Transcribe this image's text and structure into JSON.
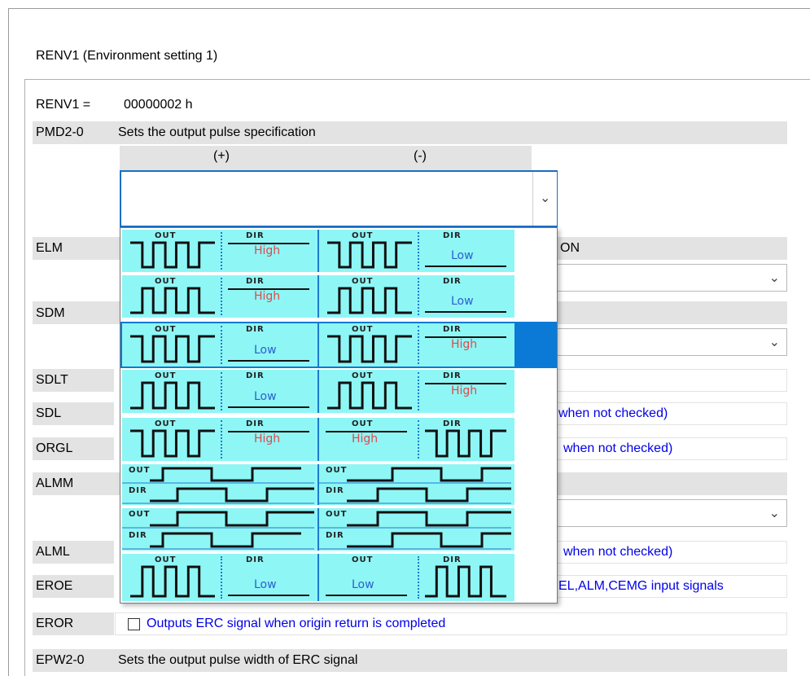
{
  "group_title": "RENV1 (Environment setting 1)",
  "renv1": {
    "label": "RENV1 =",
    "value": "00000002 h"
  },
  "pmd": {
    "code": "PMD2-0",
    "description": "Sets the output pulse specification",
    "col_plus": "(+)",
    "col_minus": "(-)",
    "selected_value": ""
  },
  "dropdown": {
    "tags": {
      "out": "OUT",
      "dir": "DIR"
    },
    "levels": {
      "high": "High",
      "low": "Low"
    },
    "selected_index": 2,
    "options": [
      {
        "kind": "pulse",
        "plus": {
          "wave": "neg",
          "dir": "High"
        },
        "minus": {
          "wave": "neg",
          "dir": "Low"
        }
      },
      {
        "kind": "pulse",
        "plus": {
          "wave": "pos",
          "dir": "High"
        },
        "minus": {
          "wave": "pos",
          "dir": "Low"
        }
      },
      {
        "kind": "pulse",
        "plus": {
          "wave": "neg",
          "dir": "Low"
        },
        "minus": {
          "wave": "neg",
          "dir": "High"
        }
      },
      {
        "kind": "pulse",
        "plus": {
          "wave": "pos",
          "dir": "Low"
        },
        "minus": {
          "wave": "pos",
          "dir": "High"
        }
      },
      {
        "kind": "swap",
        "plus": {
          "wave": "neg",
          "dir": "High"
        },
        "minus": {
          "wave": "neg",
          "dir": "High"
        }
      },
      {
        "kind": "phase"
      },
      {
        "kind": "phase"
      },
      {
        "kind": "swap",
        "plus": {
          "wave": "pos",
          "dir": "Low"
        },
        "minus": {
          "wave": "pos",
          "dir": "Low"
        }
      }
    ]
  },
  "rows": {
    "elm": {
      "code": "ELM",
      "right_text": "ON"
    },
    "sdm": {
      "code": "SDM"
    },
    "sdlt": {
      "code": "SDLT"
    },
    "sdl": {
      "code": "SDL",
      "right_text": "when not checked)"
    },
    "orgl": {
      "code": "ORGL",
      "right_text": "when not checked)"
    },
    "almm": {
      "code": "ALMM"
    },
    "alml": {
      "code": "ALML",
      "right_text": "when not checked)"
    },
    "eroe": {
      "code": "EROE",
      "right_text": "EL,ALM,CEMG input signals"
    },
    "eror": {
      "code": "EROR",
      "checkbox_label": "Outputs ERC signal when origin return is completed",
      "checked": false
    },
    "epw": {
      "code": "EPW2-0",
      "description": "Sets the output pulse width of ERC signal"
    }
  },
  "colors": {
    "list_bg": "#8ff6f6",
    "selection": "#0a7ad6",
    "high": "#e04a4a",
    "low": "#2a5fcf",
    "link_text": "#0000e8"
  }
}
